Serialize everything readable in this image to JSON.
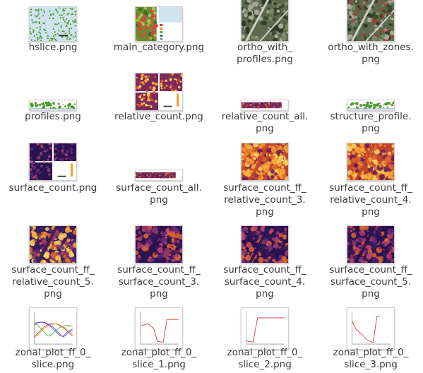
{
  "files": [
    {
      "name": "hslice.png",
      "label": "hslice.png",
      "thumb": "map-points"
    },
    {
      "name": "main_category.png",
      "label": "main_category.png",
      "thumb": "green-classes"
    },
    {
      "name": "ortho_with_profiles.png",
      "label": "ortho_with_\nprofiles.png",
      "thumb": "ortho"
    },
    {
      "name": "ortho_with_zones.png",
      "label": "ortho_with_zones.\npng",
      "thumb": "ortho-zones"
    },
    {
      "name": "profiles.png",
      "label": "profiles.png",
      "thumb": "profile"
    },
    {
      "name": "relative_count.png",
      "label": "relative_count.png",
      "thumb": "heat-quad"
    },
    {
      "name": "relative_count_all.png",
      "label": "relative_count_all.\npng",
      "thumb": "heat-strip"
    },
    {
      "name": "structure_profile.png",
      "label": "structure_profile.\npng",
      "thumb": "profile"
    },
    {
      "name": "surface_count.png",
      "label": "surface_count.png",
      "thumb": "dark-quad"
    },
    {
      "name": "surface_count_all.png",
      "label": "surface_count_all.\npng",
      "thumb": "heat-strip"
    },
    {
      "name": "surface_count_ff_relative_count_3.png",
      "label": "surface_count_ff_\nrelative_count_3.\npng",
      "thumb": "heat-orange"
    },
    {
      "name": "surface_count_ff_relative_count_4.png",
      "label": "surface_count_ff_\nrelative_count_4.\npng",
      "thumb": "heat-orange"
    },
    {
      "name": "surface_count_ff_relative_count_5.png",
      "label": "surface_count_ff_\nrelative_count_5.\npng",
      "thumb": "heat-mixed"
    },
    {
      "name": "surface_count_ff_surface_count_3.png",
      "label": "surface_count_ff_\nsurface_count_3.\npng",
      "thumb": "heat-dark"
    },
    {
      "name": "surface_count_ff_surface_count_4.png",
      "label": "surface_count_ff_\nsurface_count_4.\npng",
      "thumb": "heat-dark"
    },
    {
      "name": "surface_count_ff_surface_count_5.png",
      "label": "surface_count_ff_\nsurface_count_5.\npng",
      "thumb": "heat-dark"
    },
    {
      "name": "zonal_plot_ff_0_slice.png",
      "label": "zonal_plot_ff_0_\nslice.png",
      "thumb": "plot-multi"
    },
    {
      "name": "zonal_plot_ff_0_slice_1.png",
      "label": "zonal_plot_ff_0_\nslice_1.png",
      "thumb": "plot-red"
    },
    {
      "name": "zonal_plot_ff_0_slice_2.png",
      "label": "zonal_plot_ff_0_\nslice_2.png",
      "thumb": "plot-red-flat"
    },
    {
      "name": "zonal_plot_ff_0_slice_3.png",
      "label": "zonal_plot_ff_0_\nslice_3.png",
      "thumb": "plot-red-spike"
    }
  ],
  "colors": {
    "label_text": "#3c3c3c",
    "heat_dark": "#2a1250",
    "heat_mid": "#b0345a",
    "heat_bright": "#f4a020",
    "plot_red": "#d63a3a",
    "veg_green": "#4a9a2a",
    "water_blue": "#cfe3ee"
  }
}
